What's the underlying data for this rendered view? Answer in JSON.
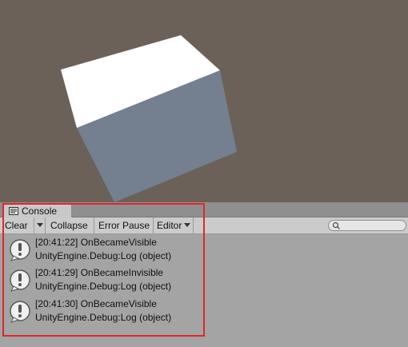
{
  "console": {
    "tab_label": "Console",
    "tab_icon": "console-icon",
    "toolbar": {
      "clear_label": "Clear",
      "collapse_label": "Collapse",
      "error_pause_label": "Error Pause",
      "editor_label": "Editor"
    },
    "search": {
      "icon": "search-icon",
      "value": ""
    },
    "log_entries": [
      {
        "icon": "warning-icon",
        "line1": "[20:41:22] OnBecameVisible",
        "line2": "UnityEngine.Debug:Log (object)"
      },
      {
        "icon": "warning-icon",
        "line1": "[20:41:29] OnBecameInvisible",
        "line2": "UnityEngine.Debug:Log (object)"
      },
      {
        "icon": "warning-icon",
        "line1": "[20:41:30] OnBecameVisible",
        "line2": "UnityEngine.Debug:Log (object)"
      }
    ]
  },
  "colors": {
    "scene_background": "#6b6158",
    "cube_top": "#ffffff",
    "cube_side": "#748090",
    "highlight": "#e0262b"
  }
}
